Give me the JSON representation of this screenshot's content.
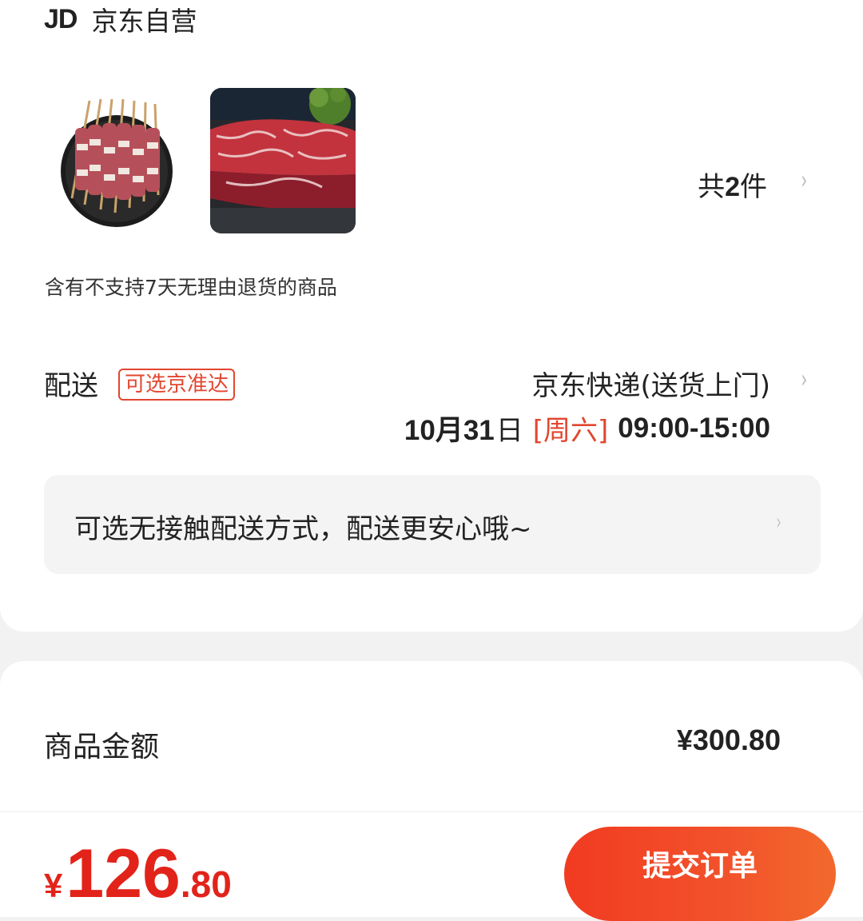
{
  "shop": {
    "logo_text": "JD",
    "name": "京东自营"
  },
  "items": {
    "products": [
      {
        "name": "lamb-skewers",
        "image": "skewers-photo"
      },
      {
        "name": "beef-steak",
        "image": "steak-photo"
      }
    ],
    "count_prefix": "共",
    "count": "2",
    "count_suffix": "件"
  },
  "return_note": "含有不支持7天无理由退货的商品",
  "delivery": {
    "label": "配送",
    "tag": "可选京准达",
    "method": "京东快递(送货上门)",
    "date": "10月31",
    "date_suffix": "日",
    "weekday": "[周六]",
    "hours": "09:00-15:00"
  },
  "contactless": {
    "text": "可选无接触配送方式，配送更安心哦~"
  },
  "amount": {
    "label": "商品金额",
    "value": "¥300.80"
  },
  "total": {
    "currency": "¥",
    "integer": "126",
    "decimal": ".80"
  },
  "submit_label": "提交订单",
  "colors": {
    "accent": "#e2231a",
    "button_start": "#f13b22",
    "button_end": "#f2692c"
  }
}
